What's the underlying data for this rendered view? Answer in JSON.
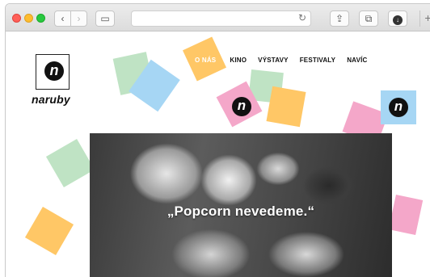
{
  "browser": {
    "back_glyph": "‹",
    "forward_glyph": "›",
    "sidebar_glyph": "▭",
    "reload_glyph": "↻",
    "share_glyph": "⇪",
    "tabs_glyph": "⧉",
    "download_glyph": "↓",
    "newtab_glyph": "+"
  },
  "logo": {
    "letter": "n",
    "wordmark": "naruby"
  },
  "nav": {
    "items": [
      {
        "label": "O NÁS",
        "active": true
      },
      {
        "label": "KINO"
      },
      {
        "label": "VÝSTAVY"
      },
      {
        "label": "FESTIVALY"
      },
      {
        "label": "NAVÍC"
      }
    ]
  },
  "badges": {
    "letter": "n"
  },
  "hero": {
    "quote": "„Popcorn nevedeme.“"
  },
  "colors": {
    "stamp_green": "#bfe3c4",
    "stamp_blue": "#a6d6f4",
    "stamp_yellow": "#ffc766",
    "stamp_pink": "#f4a7c9",
    "nav_active_text": "#ffffff"
  }
}
